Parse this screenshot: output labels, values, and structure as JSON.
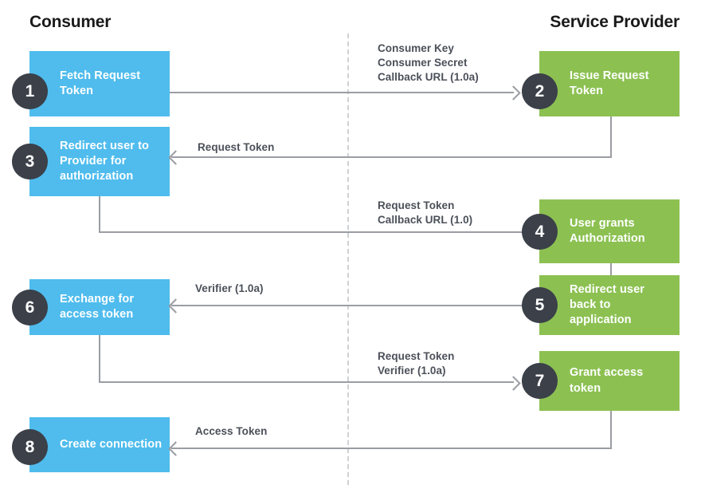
{
  "diagram": {
    "title_consumer": "Consumer",
    "title_provider": "Service Provider",
    "colors": {
      "consumer_box": "#4fbced",
      "provider_box": "#8cc152",
      "badge": "#3b4049",
      "connector": "#9a9da3",
      "divider": "#cfd1d4",
      "caption_text": "#4b5059",
      "box_text": "#ffffff",
      "heading_text": "#1a1a1a",
      "background": "#ffffff"
    },
    "steps": [
      {
        "number": "1",
        "label": "Fetch\nRequest Token",
        "side": "consumer"
      },
      {
        "number": "2",
        "label": "Issue\nRequest Token",
        "side": "provider"
      },
      {
        "number": "3",
        "label": "Redirect user\nto Provider for\nauthorization",
        "side": "consumer"
      },
      {
        "number": "4",
        "label": "User grants\nAuthorization",
        "side": "provider"
      },
      {
        "number": "5",
        "label": "Redirect user\nback to\napplication",
        "side": "provider"
      },
      {
        "number": "6",
        "label": "Exchange for\naccess token",
        "side": "consumer"
      },
      {
        "number": "7",
        "label": "Grant access\ntoken",
        "side": "provider"
      },
      {
        "number": "8",
        "label": "Create\nconnection",
        "side": "consumer"
      }
    ],
    "connectors": [
      {
        "id": "c1",
        "caption": "Consumer Key\nConsumer Secret\nCallback URL (1.0a)",
        "direction": "right",
        "from": "1",
        "to": "2"
      },
      {
        "id": "c2",
        "caption": "Request Token",
        "direction": "left",
        "from": "2",
        "to": "3"
      },
      {
        "id": "c3",
        "caption": "Request Token\nCallback URL (1.0)",
        "direction": "right",
        "from": "3",
        "to": "4"
      },
      {
        "id": "c4",
        "caption": "Verifier (1.0a)",
        "direction": "left",
        "from": "5",
        "to": "6"
      },
      {
        "id": "c5",
        "caption": "Request Token\nVerifier (1.0a)",
        "direction": "right",
        "from": "6",
        "to": "7"
      },
      {
        "id": "c6",
        "caption": "Access Token",
        "direction": "left",
        "from": "7",
        "to": "8"
      }
    ]
  }
}
